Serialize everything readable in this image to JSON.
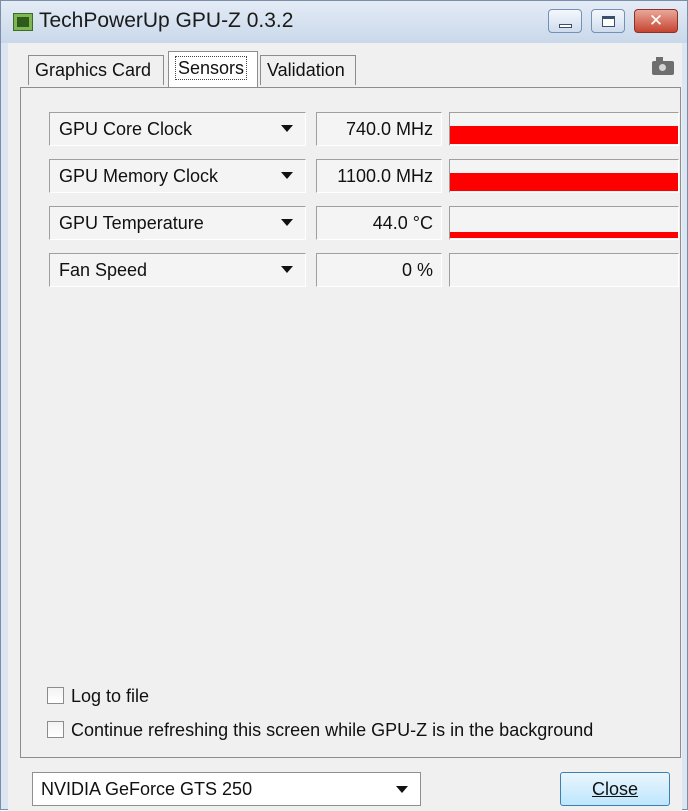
{
  "window": {
    "title": "TechPowerUp GPU-Z 0.3.2",
    "controls": {
      "close_glyph": "✕"
    }
  },
  "tabs": [
    {
      "label": "Graphics Card",
      "selected": false
    },
    {
      "label": "Sensors",
      "selected": true
    },
    {
      "label": "Validation",
      "selected": false
    }
  ],
  "sensors": [
    {
      "name": "GPU Core Clock",
      "value": "740.0 MHz",
      "graph_level": 0.55
    },
    {
      "name": "GPU Memory Clock",
      "value": "1100.0 MHz",
      "graph_level": 0.55
    },
    {
      "name": "GPU Temperature",
      "value": "44.0 °C",
      "graph_level": 0.2
    },
    {
      "name": "Fan Speed",
      "value": "0 %",
      "graph_level": 0
    }
  ],
  "options": {
    "log_to_file": {
      "label": "Log to file",
      "checked": false
    },
    "continue_refreshing": {
      "label": "Continue refreshing this screen while GPU-Z is in the background",
      "checked": false
    }
  },
  "footer": {
    "gpu_select": "NVIDIA GeForce GTS 250",
    "close_button": "Close"
  },
  "colors": {
    "graph_fill": "#ff0000",
    "accent": "#3c7fb1"
  },
  "icons": [
    "app-icon",
    "minimize-icon",
    "maximize-icon",
    "close-icon",
    "camera-icon",
    "chevron-down-icon"
  ]
}
